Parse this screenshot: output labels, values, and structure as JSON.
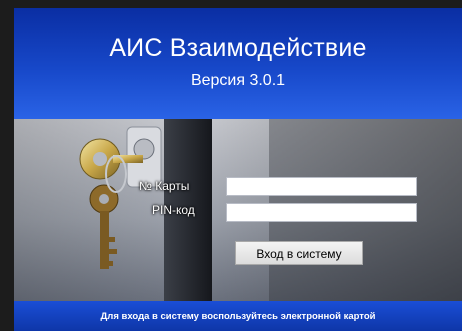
{
  "header": {
    "app_title": "АИС Взаимодействие",
    "version": "Версия 3.0.1"
  },
  "login_form": {
    "card_label": "№ Карты",
    "card_value": "",
    "pin_label": "PIN-код",
    "pin_value": "",
    "login_button_label": "Вход в систему"
  },
  "footer": {
    "hint": "Для входа в систему воспользуйтесь электронной картой"
  },
  "colors": {
    "header_blue": "#1748c9",
    "footer_blue": "#1a4ed6",
    "window_background": "#0d2a86"
  },
  "icons": {
    "background_image": "keys-in-lock-icon"
  }
}
